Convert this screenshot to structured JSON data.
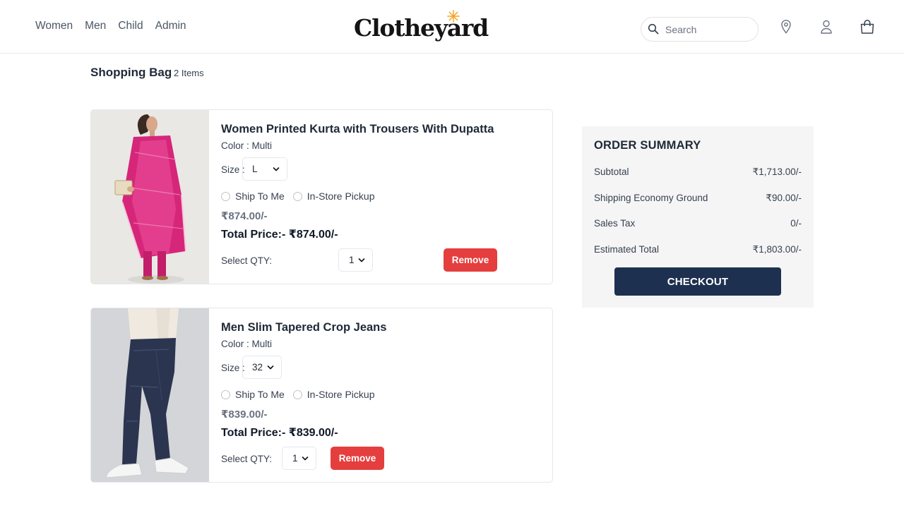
{
  "nav": {
    "items": [
      "Women",
      "Men",
      "Child",
      "Admin"
    ]
  },
  "brand": {
    "logo_text": "Clotheyard",
    "accent_color": "#f5a623"
  },
  "search": {
    "placeholder": "Search"
  },
  "header_icons": [
    "location-icon",
    "user-icon",
    "shopping-bag-icon"
  ],
  "bag": {
    "title": "Shopping Bag",
    "count": "2 Items"
  },
  "products": [
    {
      "name": "Women Printed Kurta with Trousers With Dupatta",
      "color": "Color : Multi",
      "size_label": "Size :",
      "size": "L",
      "ship_option": "Ship To Me",
      "pickup_option": "In-Store Pickup",
      "price": "₹874.00/-",
      "total": "Total Price:- ₹874.00/-",
      "qty_label": "Select QTY:",
      "qty": "1",
      "remove_label": "Remove"
    },
    {
      "name": "Men Slim Tapered Crop Jeans",
      "color": "Color : Multi",
      "size_label": "Size :",
      "size": "32",
      "ship_option": "Ship To Me",
      "pickup_option": "In-Store Pickup",
      "price": "₹839.00/-",
      "total": "Total Price:- ₹839.00/-",
      "qty_label": "Select QTY:",
      "qty": "1",
      "remove_label": "Remove"
    }
  ],
  "summary": {
    "title": "ORDER SUMMARY",
    "rows": [
      {
        "label": "Subtotal",
        "value": "₹1,713.00/-"
      },
      {
        "label": "Shipping Economy Ground",
        "value": "₹90.00/-"
      },
      {
        "label": "Sales Tax",
        "value": "0/-"
      },
      {
        "label": "Estimated Total",
        "value": "₹1,803.00/-"
      }
    ],
    "checkout_label": "CHECKOUT"
  },
  "colors": {
    "remove": "#e53e3e",
    "checkout": "#1e3050",
    "summary_bg": "#f5f5f5"
  }
}
